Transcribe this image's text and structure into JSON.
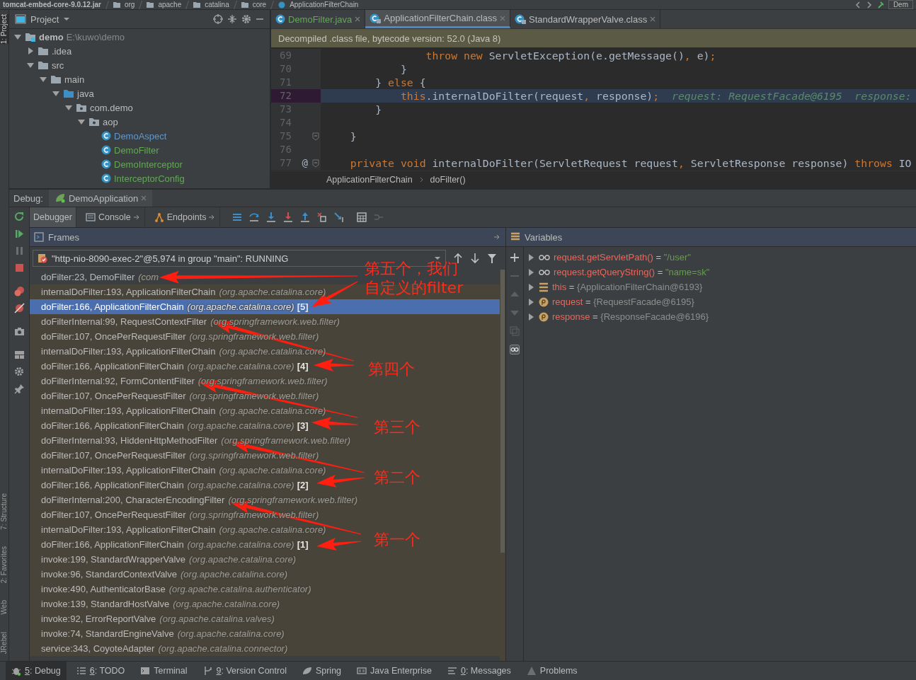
{
  "top_bar": {
    "breadcrumbs": [
      "tomcat-embed-core-9.0.12.jar",
      "org",
      "apache",
      "catalina",
      "core",
      "ApplicationFilterChain"
    ],
    "run_config": "Dem"
  },
  "left_stripe": [
    {
      "label": "1: Project",
      "selected": true
    },
    {
      "label": "7: Structure",
      "selected": false
    },
    {
      "label": "2: Favorites",
      "selected": false
    },
    {
      "label": "Web",
      "selected": false
    },
    {
      "label": "JRebel",
      "selected": false
    }
  ],
  "project": {
    "title": "Project",
    "tree": [
      {
        "name": "demo",
        "path": "E:\\kuwo\\demo",
        "kind": "module",
        "expanded": true,
        "children": [
          {
            "name": ".idea",
            "kind": "folder",
            "expanded": false
          },
          {
            "name": "src",
            "kind": "folder",
            "expanded": true,
            "children": [
              {
                "name": "main",
                "kind": "folder",
                "expanded": true,
                "children": [
                  {
                    "name": "java",
                    "kind": "source",
                    "expanded": true,
                    "children": [
                      {
                        "name": "com.demo",
                        "kind": "package",
                        "expanded": true,
                        "children": [
                          {
                            "name": "aop",
                            "kind": "package",
                            "expanded": true,
                            "children": [
                              {
                                "name": "DemoAspect",
                                "kind": "class",
                                "color": "#5f97cf"
                              },
                              {
                                "name": "DemoFilter",
                                "kind": "class",
                                "color": "#62a855"
                              },
                              {
                                "name": "DemoInterceptor",
                                "kind": "class",
                                "color": "#62a855"
                              },
                              {
                                "name": "InterceptorConfig",
                                "kind": "class",
                                "color": "#62a855"
                              }
                            ]
                          }
                        ]
                      }
                    ]
                  }
                ]
              }
            ]
          }
        ]
      }
    ]
  },
  "editor": {
    "tabs": [
      {
        "name": "DemoFilter.java",
        "kind": "source",
        "selected": false,
        "color": "#62a855"
      },
      {
        "name": "ApplicationFilterChain.class",
        "kind": "compiled",
        "selected": true,
        "color": "#bbbbbb"
      },
      {
        "name": "StandardWrapperValve.class",
        "kind": "compiled",
        "selected": false,
        "color": "#bbbbbb"
      }
    ],
    "banner": "Decompiled .class file, bytecode version: 52.0 (Java 8)",
    "lines": [
      {
        "number": "69",
        "current": false,
        "tokens": [
          {
            "text": "                throw new",
            "kind": "keyword"
          },
          {
            "text": " ServletException(e.getMessage()",
            "kind": "plain"
          },
          {
            "text": ",",
            "kind": "keyword"
          },
          {
            "text": " e)",
            "kind": "plain"
          },
          {
            "text": ";",
            "kind": "keyword"
          }
        ]
      },
      {
        "number": "70",
        "current": false,
        "tokens": [
          {
            "text": "            }",
            "kind": "plain"
          }
        ]
      },
      {
        "number": "71",
        "current": false,
        "tokens": [
          {
            "text": "        } ",
            "kind": "plain"
          },
          {
            "text": "else",
            "kind": "keyword"
          },
          {
            "text": " {",
            "kind": "plain"
          }
        ]
      },
      {
        "number": "72",
        "current": true,
        "tokens": [
          {
            "text": "            this",
            "kind": "keyword"
          },
          {
            "text": ".internalDoFilter(request",
            "kind": "plain"
          },
          {
            "text": ",",
            "kind": "keyword"
          },
          {
            "text": " response)",
            "kind": "plain"
          },
          {
            "text": ";",
            "kind": "keyword"
          },
          {
            "text": "  request: RequestFacade@6195  response:",
            "kind": "hint"
          }
        ]
      },
      {
        "number": "73",
        "current": false,
        "tokens": [
          {
            "text": "        }",
            "kind": "plain"
          }
        ]
      },
      {
        "number": "74",
        "current": false
      },
      {
        "number": "75",
        "current": false,
        "fold": true,
        "tokens": [
          {
            "text": "    }",
            "kind": "plain"
          }
        ]
      },
      {
        "number": "76",
        "current": false
      },
      {
        "number": "77",
        "current": false,
        "fold": true,
        "gutter_mark": "@",
        "tokens": [
          {
            "text": "    private void",
            "kind": "keyword"
          },
          {
            "text": " internalDoFilter(ServletRequest request",
            "kind": "plain"
          },
          {
            "text": ",",
            "kind": "keyword"
          },
          {
            "text": " ServletResponse response) ",
            "kind": "plain"
          },
          {
            "text": "throws",
            "kind": "keyword"
          },
          {
            "text": " IO",
            "kind": "plain"
          }
        ]
      }
    ],
    "breadcrumb": [
      "ApplicationFilterChain",
      "doFilter()"
    ]
  },
  "debug": {
    "label": "Debug:",
    "session": "DemoApplication",
    "tabs": [
      {
        "label": "Debugger",
        "selected": true
      },
      {
        "label": "Console",
        "selected": false
      },
      {
        "label": "Endpoints",
        "selected": false
      }
    ],
    "frames": {
      "title": "Frames",
      "thread": "\"http-nio-8090-exec-2\"@5,974 in group \"main\": RUNNING",
      "items": [
        {
          "method": "doFilter:23, DemoFilter",
          "package": "(com",
          "kind": "app",
          "selected": false
        },
        {
          "method": "internalDoFilter:193, ApplicationFilterChain",
          "package": "(org.apache.catalina.core)",
          "kind": "library",
          "selected": false
        },
        {
          "method": "doFilter:166, ApplicationFilterChain",
          "package": "(org.apache.catalina.core)",
          "badge": "[5]",
          "kind": "library",
          "selected": true
        },
        {
          "method": "doFilterInternal:99, RequestContextFilter",
          "package": "(org.springframework.web.filter)",
          "kind": "library",
          "selected": false
        },
        {
          "method": "doFilter:107, OncePerRequestFilter",
          "package": "(org.springframework.web.filter)",
          "kind": "library",
          "selected": false
        },
        {
          "method": "internalDoFilter:193, ApplicationFilterChain",
          "package": "(org.apache.catalina.core)",
          "kind": "library",
          "selected": false
        },
        {
          "method": "doFilter:166, ApplicationFilterChain",
          "package": "(org.apache.catalina.core)",
          "badge": "[4]",
          "kind": "library",
          "selected": false
        },
        {
          "method": "doFilterInternal:92, FormContentFilter",
          "package": "(org.springframework.web.filter)",
          "kind": "library",
          "selected": false
        },
        {
          "method": "doFilter:107, OncePerRequestFilter",
          "package": "(org.springframework.web.filter)",
          "kind": "library",
          "selected": false
        },
        {
          "method": "internalDoFilter:193, ApplicationFilterChain",
          "package": "(org.apache.catalina.core)",
          "kind": "library",
          "selected": false
        },
        {
          "method": "doFilter:166, ApplicationFilterChain",
          "package": "(org.apache.catalina.core)",
          "badge": "[3]",
          "kind": "library",
          "selected": false
        },
        {
          "method": "doFilterInternal:93, HiddenHttpMethodFilter",
          "package": "(org.springframework.web.filter)",
          "kind": "library",
          "selected": false
        },
        {
          "method": "doFilter:107, OncePerRequestFilter",
          "package": "(org.springframework.web.filter)",
          "kind": "library",
          "selected": false
        },
        {
          "method": "internalDoFilter:193, ApplicationFilterChain",
          "package": "(org.apache.catalina.core)",
          "kind": "library",
          "selected": false
        },
        {
          "method": "doFilter:166, ApplicationFilterChain",
          "package": "(org.apache.catalina.core)",
          "badge": "[2]",
          "kind": "library",
          "selected": false
        },
        {
          "method": "doFilterInternal:200, CharacterEncodingFilter",
          "package": "(org.springframework.web.filter)",
          "kind": "library",
          "selected": false
        },
        {
          "method": "doFilter:107, OncePerRequestFilter",
          "package": "(org.springframework.web.filter)",
          "kind": "library",
          "selected": false
        },
        {
          "method": "internalDoFilter:193, ApplicationFilterChain",
          "package": "(org.apache.catalina.core)",
          "kind": "library",
          "selected": false
        },
        {
          "method": "doFilter:166, ApplicationFilterChain",
          "package": "(org.apache.catalina.core)",
          "badge": "[1]",
          "kind": "library",
          "selected": false
        },
        {
          "method": "invoke:199, StandardWrapperValve",
          "package": "(org.apache.catalina.core)",
          "kind": "library",
          "selected": false
        },
        {
          "method": "invoke:96, StandardContextValve",
          "package": "(org.apache.catalina.core)",
          "kind": "library",
          "selected": false
        },
        {
          "method": "invoke:490, AuthenticatorBase",
          "package": "(org.apache.catalina.authenticator)",
          "kind": "library",
          "selected": false
        },
        {
          "method": "invoke:139, StandardHostValve",
          "package": "(org.apache.catalina.core)",
          "kind": "library",
          "selected": false
        },
        {
          "method": "invoke:92, ErrorReportValve",
          "package": "(org.apache.catalina.valves)",
          "kind": "library",
          "selected": false
        },
        {
          "method": "invoke:74, StandardEngineValve",
          "package": "(org.apache.catalina.core)",
          "kind": "library",
          "selected": false
        },
        {
          "method": "service:343, CoyoteAdapter",
          "package": "(org.apache.catalina.connector)",
          "kind": "library",
          "selected": false
        }
      ]
    },
    "variables": {
      "title": "Variables",
      "items": [
        {
          "kind": "watch",
          "name": "request.getServletPath()",
          "operator": "=",
          "value": "\"/user\"",
          "color": "#6a9955"
        },
        {
          "kind": "watch",
          "name": "request.getQueryString()",
          "operator": "=",
          "value": "\"name=sk\"",
          "color": "#6a9955"
        },
        {
          "kind": "object",
          "name": "this",
          "operator": "=",
          "value": "{ApplicationFilterChain@6193}",
          "color": "#8d8d8d"
        },
        {
          "kind": "param",
          "name": "request",
          "operator": "=",
          "value": "{RequestFacade@6195}",
          "color": "#8d8d8d"
        },
        {
          "kind": "param",
          "name": "response",
          "operator": "=",
          "value": "{ResponseFacade@6196}",
          "color": "#8d8d8d"
        }
      ]
    }
  },
  "annotations": [
    {
      "text": "第五个，我们自定义的filter"
    },
    {
      "text": "第四个"
    },
    {
      "text": "第三个"
    },
    {
      "text": "第二个"
    },
    {
      "text": "第一个"
    }
  ],
  "status_bar": [
    {
      "mnemonic": "5",
      "label": ": Debug",
      "kind": "debug",
      "selected": true
    },
    {
      "mnemonic": "6",
      "label": ": TODO",
      "kind": "todo",
      "selected": false
    },
    {
      "label": "Terminal",
      "kind": "terminal",
      "selected": false
    },
    {
      "mnemonic": "9",
      "label": ": Version Control",
      "kind": "vcs",
      "selected": false
    },
    {
      "label": "Spring",
      "kind": "spring",
      "selected": false
    },
    {
      "label": "Java Enterprise",
      "kind": "enterprise",
      "selected": false
    },
    {
      "mnemonic": "0",
      "label": ": Messages",
      "kind": "messages",
      "selected": false
    },
    {
      "label": "Problems",
      "kind": "problems",
      "selected": false
    }
  ]
}
